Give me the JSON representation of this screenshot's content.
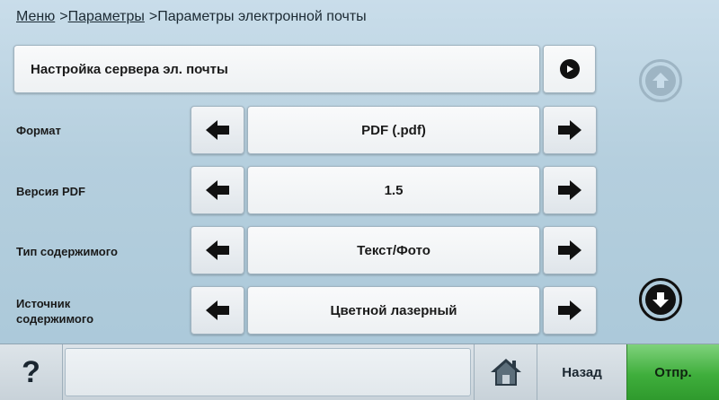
{
  "breadcrumb": {
    "menu": "Меню",
    "sep1": ">",
    "params": "Параметры",
    "sep2": ">",
    "current": "Параметры электронной почты"
  },
  "server_settings": {
    "label": "Настройка сервера эл. почты"
  },
  "rows": [
    {
      "label": "Формат",
      "value": "PDF (.pdf)"
    },
    {
      "label": "Версия PDF",
      "value": "1.5"
    },
    {
      "label": "Тип содержимого",
      "value": "Текст/Фото"
    },
    {
      "label_line1": "Источник",
      "label_line2": "содержимого",
      "value": "Цветной лазерный"
    }
  ],
  "footer": {
    "help": "?",
    "back": "Назад",
    "send": "Отпр."
  },
  "colors": {
    "send_green": "#3fae3c",
    "scroll_up_disabled": "#9eb5c4",
    "scroll_down_active": "#111111"
  },
  "icons": {
    "go": "arrow-right-circle-icon",
    "prev": "arrow-left-icon",
    "next": "arrow-right-icon",
    "scroll_up": "arrow-up-circle-icon",
    "scroll_down": "arrow-down-circle-icon",
    "home": "home-icon"
  }
}
